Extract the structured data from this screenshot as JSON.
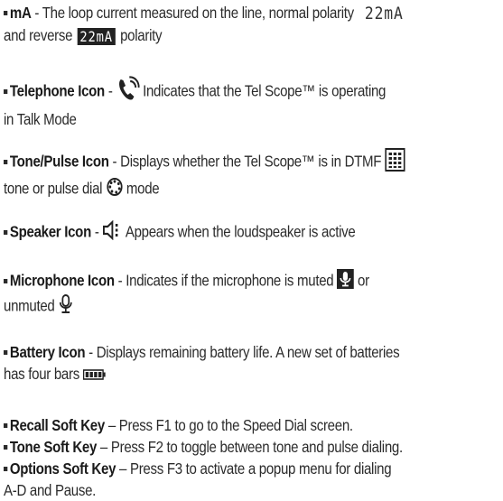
{
  "items": [
    {
      "term": "mA",
      "text1": " - The loop current measured on the line, normal polarity",
      "lcd_normal": "22mA",
      "text2_pre": "and reverse ",
      "lcd_reverse": "22mA",
      "text2_post": " polarity"
    },
    {
      "term": "Telephone Icon",
      "text1_pre": " - ",
      "text1_post": " Indicates that the Tel Scope™ is operating",
      "text2": "in Talk Mode"
    },
    {
      "term": "Tone/Pulse Icon",
      "text1": " - Displays whether the Tel Scope™ is in DTMF",
      "text2_pre": "tone or pulse dial ",
      "text2_post": " mode"
    },
    {
      "term": "Speaker Icon",
      "text1_pre": " - ",
      "text1_post": " Appears when the loudspeaker is active"
    },
    {
      "term": "Microphone Icon",
      "text1": " - Indicates if the microphone is muted ",
      "text1_post": " or",
      "text2": "unmuted "
    },
    {
      "term": "Battery Icon",
      "text1": " - Displays remaining battery life. A new set of batteries",
      "text2": "has four bars "
    },
    {
      "term": "Recall Soft Key",
      "text1": " – Press F1 to go to the Speed Dial screen."
    },
    {
      "term": "Tone Soft Key",
      "text1": " – Press F2 to toggle between tone and pulse dialing."
    },
    {
      "term": "Options Soft Key",
      "text1": " – Press F3 to activate a popup menu for dialing",
      "text2": "A-D and Pause."
    }
  ],
  "icons": {
    "telephone": "telephone-talk-icon",
    "dtmf": "dtmf-keypad-icon",
    "pulse": "pulse-dial-icon",
    "speaker": "speaker-icon",
    "mic_muted": "microphone-muted-icon",
    "mic_unmuted": "microphone-unmuted-icon",
    "battery": "battery-four-bars-icon"
  },
  "colors": {
    "text": "#2b2b2b",
    "lcd_reverse_bg": "#222222"
  }
}
